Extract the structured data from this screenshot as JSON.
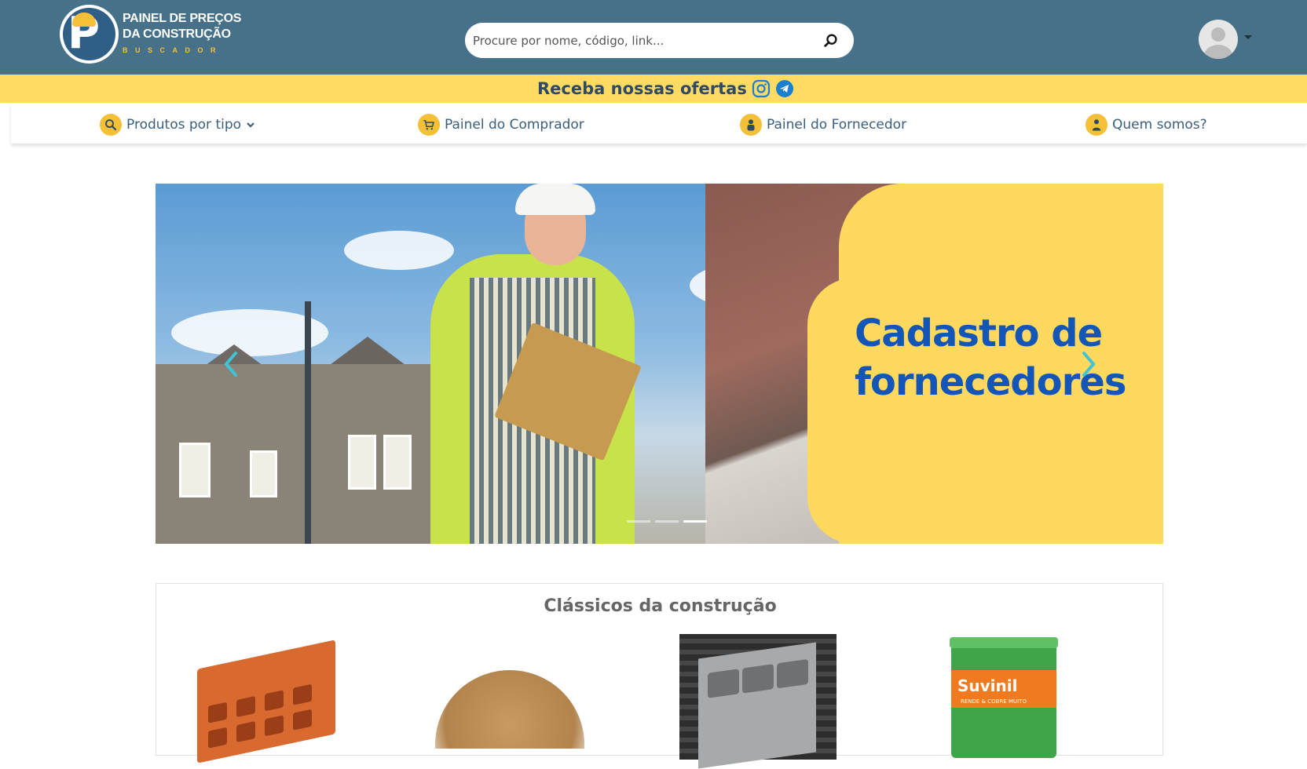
{
  "header": {
    "logo": {
      "title_line1": "PAINEL DE PREÇOS",
      "title_line2": "DA CONSTRUÇÃO",
      "subtitle": "BUSCADOR",
      "letter": "P"
    },
    "search": {
      "placeholder": "Procure por nome, código, link...",
      "value": ""
    },
    "user_menu_icon": "avatar-icon"
  },
  "offers": {
    "text": "Receba nossas ofertas",
    "icons": [
      "instagram-icon",
      "telegram-icon"
    ]
  },
  "nav": {
    "items": [
      {
        "label": "Produtos por tipo",
        "icon": "search-icon"
      },
      {
        "label": "Painel do Comprador",
        "icon": "cart-icon"
      },
      {
        "label": "Painel do Fornecedor",
        "icon": "supplier-icon"
      },
      {
        "label": "Quem somos?",
        "icon": "about-icon"
      }
    ]
  },
  "banner": {
    "line1": "Cadastro de",
    "line2": "fornecedores",
    "slide_count": 3,
    "active_slide": 3
  },
  "classics": {
    "title": "Clássicos da construção",
    "products": [
      "brick",
      "sand",
      "concrete-block",
      "paint-bucket"
    ],
    "paint_brand": "Suvinil",
    "paint_tag": "RENDE & COBRE MUITO"
  },
  "colors": {
    "header_bg": "#467189",
    "offers_bg": "#ffdb64",
    "accent_yellow": "#f4c038",
    "nav_text": "#3a5f7d",
    "banner_text": "#1456b8"
  }
}
